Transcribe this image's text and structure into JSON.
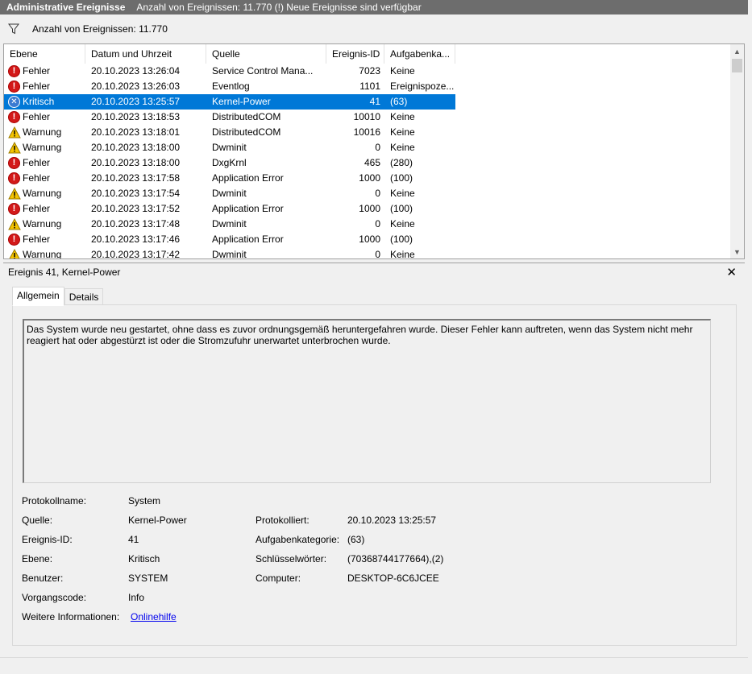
{
  "titlebar": {
    "title": "Administrative Ereignisse",
    "info": "Anzahl von Ereignissen: 11.770 (!) Neue Ereignisse sind verfügbar"
  },
  "filterbar": {
    "count_text": "Anzahl von Ereignissen: 11.770",
    "icon": "filter-funnel-icon"
  },
  "columns": [
    "Ebene",
    "Datum und Uhrzeit",
    "Quelle",
    "Ereignis-ID",
    "Aufgabenka..."
  ],
  "events": [
    {
      "level": "Fehler",
      "type": "error",
      "date": "20.10.2023 13:26:04",
      "source": "Service Control Mana...",
      "id": "7023",
      "task": "Keine"
    },
    {
      "level": "Fehler",
      "type": "error",
      "date": "20.10.2023 13:26:03",
      "source": "Eventlog",
      "id": "1101",
      "task": "Ereignispoze..."
    },
    {
      "level": "Kritisch",
      "type": "critical",
      "date": "20.10.2023 13:25:57",
      "source": "Kernel-Power",
      "id": "41",
      "task": "(63)",
      "selected": true
    },
    {
      "level": "Fehler",
      "type": "error",
      "date": "20.10.2023 13:18:53",
      "source": "DistributedCOM",
      "id": "10010",
      "task": "Keine"
    },
    {
      "level": "Warnung",
      "type": "warning",
      "date": "20.10.2023 13:18:01",
      "source": "DistributedCOM",
      "id": "10016",
      "task": "Keine"
    },
    {
      "level": "Warnung",
      "type": "warning",
      "date": "20.10.2023 13:18:00",
      "source": "Dwminit",
      "id": "0",
      "task": "Keine"
    },
    {
      "level": "Fehler",
      "type": "error",
      "date": "20.10.2023 13:18:00",
      "source": "DxgKrnl",
      "id": "465",
      "task": "(280)"
    },
    {
      "level": "Fehler",
      "type": "error",
      "date": "20.10.2023 13:17:58",
      "source": "Application Error",
      "id": "1000",
      "task": "(100)"
    },
    {
      "level": "Warnung",
      "type": "warning",
      "date": "20.10.2023 13:17:54",
      "source": "Dwminit",
      "id": "0",
      "task": "Keine"
    },
    {
      "level": "Fehler",
      "type": "error",
      "date": "20.10.2023 13:17:52",
      "source": "Application Error",
      "id": "1000",
      "task": "(100)"
    },
    {
      "level": "Warnung",
      "type": "warning",
      "date": "20.10.2023 13:17:48",
      "source": "Dwminit",
      "id": "0",
      "task": "Keine"
    },
    {
      "level": "Fehler",
      "type": "error",
      "date": "20.10.2023 13:17:46",
      "source": "Application Error",
      "id": "1000",
      "task": "(100)"
    },
    {
      "level": "Warnung",
      "type": "warning",
      "date": "20.10.2023 13:17:42",
      "source": "Dwminit",
      "id": "0",
      "task": "Keine"
    }
  ],
  "detail": {
    "header": "Ereignis 41, Kernel-Power",
    "tabs": [
      "Allgemein",
      "Details"
    ],
    "description": "Das System wurde neu gestartet, ohne dass es zuvor ordnungsgemäß heruntergefahren wurde. Dieser Fehler kann auftreten, wenn das System nicht mehr reagiert hat oder abgestürzt ist oder die Stromzufuhr unerwartet unterbrochen wurde.",
    "labels": {
      "log_name": "Protokollname:",
      "source": "Quelle:",
      "event_id": "Ereignis-ID:",
      "level": "Ebene:",
      "user": "Benutzer:",
      "opcode": "Vorgangscode:",
      "more_info": "Weitere Informationen:",
      "logged": "Protokolliert:",
      "task_category": "Aufgabenkategorie:",
      "keywords": "Schlüsselwörter:",
      "computer": "Computer:"
    },
    "values": {
      "log_name": "System",
      "source": "Kernel-Power",
      "event_id": "41",
      "level": "Kritisch",
      "user": "SYSTEM",
      "opcode": "Info",
      "more_info": "Onlinehilfe",
      "logged": "20.10.2023 13:25:57",
      "task_category": "(63)",
      "keywords": "(70368744177664),(2)",
      "computer": "DESKTOP-6C6JCEE"
    }
  },
  "colors": {
    "titlebar": "#6d6d6d",
    "selection": "#0078d7",
    "error": "#d31919",
    "warning": "#f5c400",
    "critical": "#3b7ad1",
    "link": "#0000ee"
  }
}
